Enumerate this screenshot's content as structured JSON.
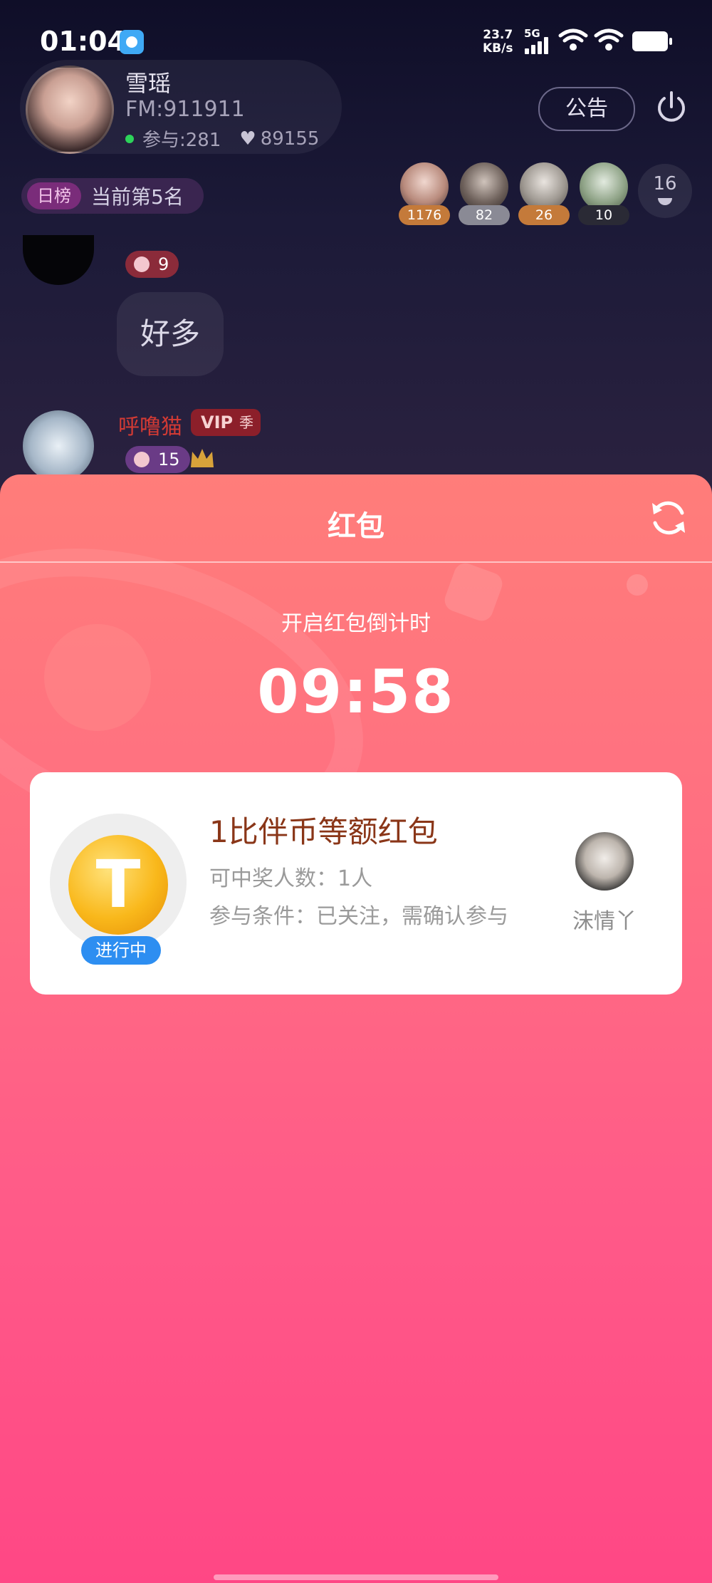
{
  "status_bar": {
    "time": "01:04",
    "net_speed_value": "23.7",
    "net_speed_unit": "KB/s",
    "network": "5G"
  },
  "room": {
    "host_name": "雪瑶",
    "fm_id": "FM:911911",
    "participants": "参与:281",
    "likes": "89155",
    "notice_label": "公告",
    "rank_tag": "日榜",
    "rank_text": "当前第5名",
    "fans": [
      {
        "count": "1176",
        "badge_color": "#c47a3a"
      },
      {
        "count": "82",
        "badge_color": "#8a8a95"
      },
      {
        "count": "26",
        "badge_color": "#c47a3a"
      },
      {
        "count": "10",
        "badge_color": "#2a2a35"
      }
    ],
    "online_count": "16"
  },
  "chat": {
    "messages": [
      {
        "level": "9",
        "text": "好多"
      },
      {
        "name": "呼噜猫",
        "vip_label": "VIP",
        "vip_season": "季",
        "level": "15"
      }
    ]
  },
  "red_envelope": {
    "title": "红包",
    "countdown_label": "开启红包倒计时",
    "countdown": "09:58",
    "card": {
      "coin_symbol": "T",
      "status": "进行中",
      "title": "1比伴币等额红包",
      "winners": "可中奖人数：1人",
      "condition": "参与条件：已关注，需确认参与",
      "sender_name": "沫情丫"
    }
  },
  "colors": {
    "panel_top": "#ff7d7a",
    "panel_bottom": "#ff4785",
    "card_title": "#8a3618",
    "status_pill": "#2d8ef1"
  }
}
